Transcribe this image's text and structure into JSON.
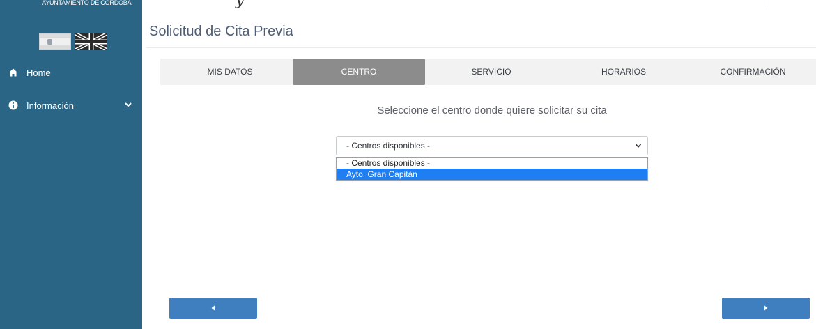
{
  "header": {
    "partial_script_text": "y"
  },
  "sidebar": {
    "org_name": "AYUNTAMIENTO DE CÓRDOBA",
    "languages": [
      {
        "icon": "spanish-flag-icon"
      },
      {
        "icon": "uk-flag-icon"
      }
    ],
    "items": [
      {
        "label": "Home",
        "icon": "home-icon"
      },
      {
        "label": "Información",
        "icon": "info-circle-icon",
        "expand_icon": "chevron-down-icon"
      }
    ],
    "background_color": "#2b6585"
  },
  "main": {
    "title": "Solicitud de Cita Previa",
    "steps": [
      {
        "label": "MIS DATOS",
        "active": false
      },
      {
        "label": "CENTRO",
        "active": true
      },
      {
        "label": "SERVICIO",
        "active": false
      },
      {
        "label": "HORARIOS",
        "active": false
      },
      {
        "label": "CONFIRMACIÓN",
        "active": false
      }
    ],
    "prompt": "Seleccione el centro donde quiere solicitar su cita",
    "center_select": {
      "selected": "- Centros disponibles -",
      "options": [
        "- Centros disponibles -",
        "Ayto. Gran Capitán"
      ],
      "highlighted_option": "Ayto. Gran Capitán"
    },
    "buttons": {
      "prev_icon": "caret-left-icon",
      "next_icon": "caret-right-icon"
    }
  },
  "colors": {
    "accent_blue": "#3f7fbf",
    "active_step": "#8c8c8c",
    "highlight": "#1e7ef2"
  }
}
